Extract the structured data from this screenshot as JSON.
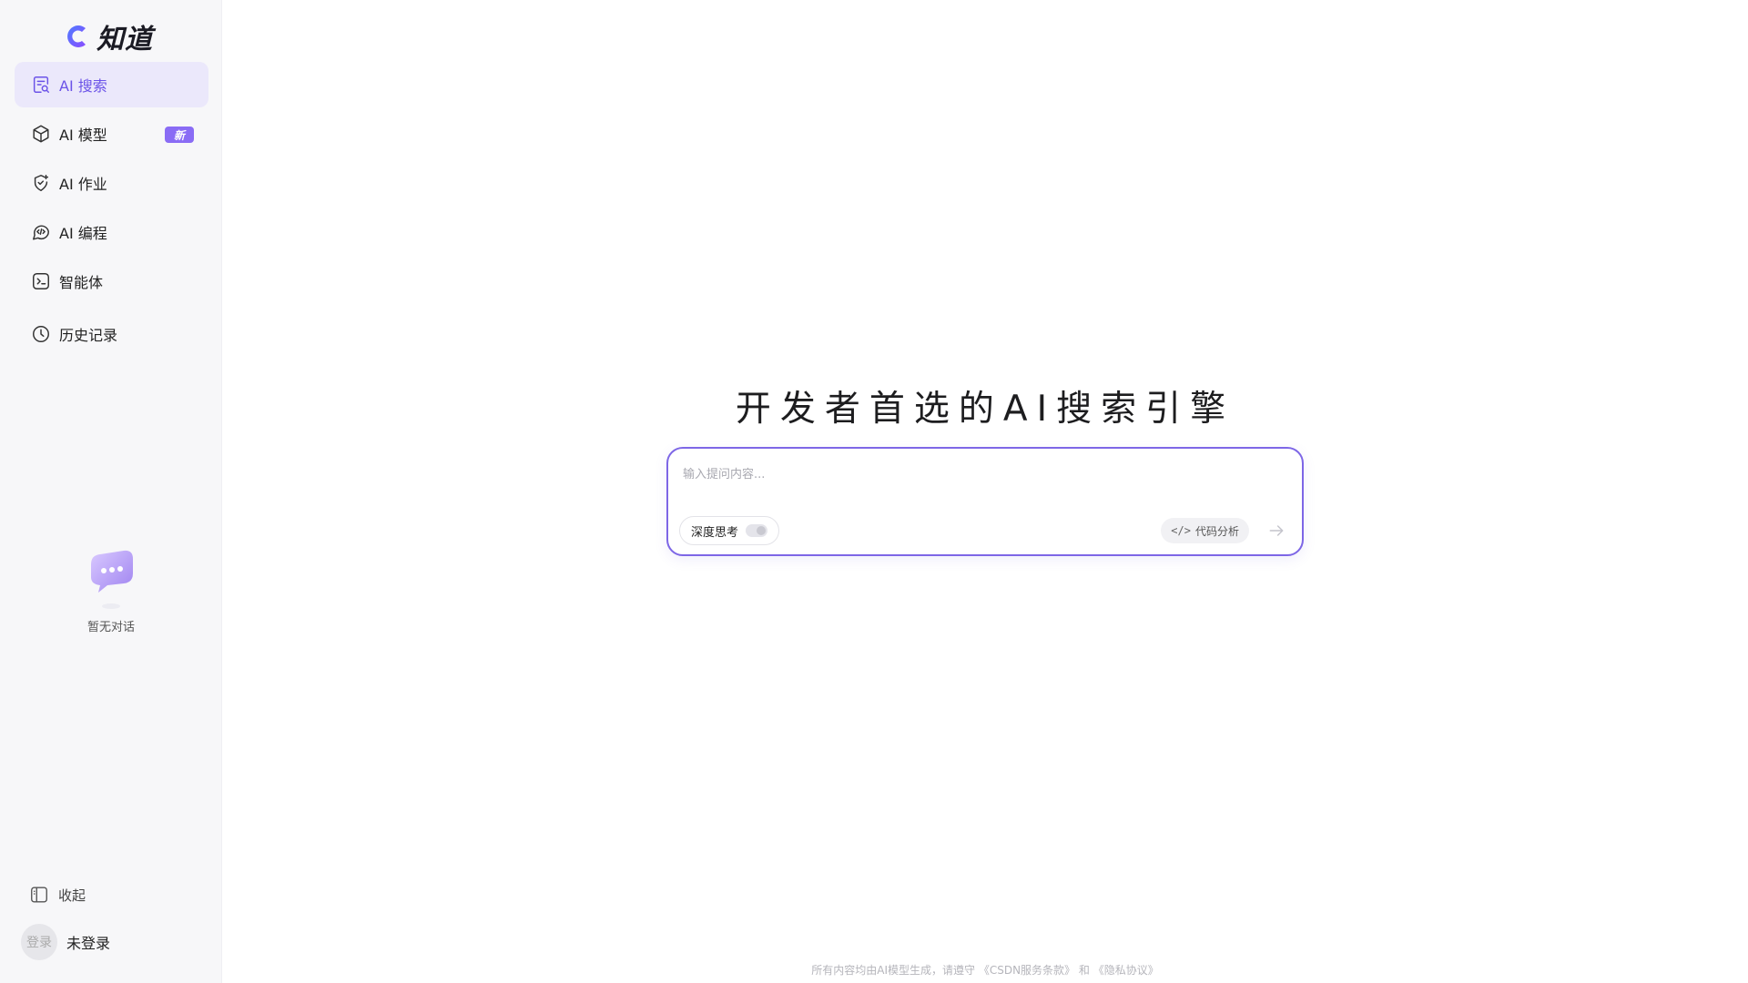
{
  "brand": {
    "name": "知道",
    "accent": "#7d66e6",
    "badge_color": "#8a6cf5"
  },
  "sidebar": {
    "items": [
      {
        "label": "AI 搜索",
        "icon": "ai-search-icon",
        "active": true
      },
      {
        "label": "AI 模型",
        "icon": "cube-icon",
        "badge": "新"
      },
      {
        "label": "AI 作业",
        "icon": "shield-sparkle-icon"
      },
      {
        "label": "AI 编程",
        "icon": "code-chat-icon"
      },
      {
        "label": "智能体",
        "icon": "terminal-icon"
      },
      {
        "label": "历史记录",
        "icon": "clock-icon"
      }
    ],
    "empty_text": "暂无对话",
    "collapse_label": "收起",
    "avatar_text": "登录",
    "user_label": "未登录"
  },
  "main": {
    "headline": "开发者首选的AI搜索引擎",
    "search": {
      "placeholder": "输入提问内容...",
      "deep_think_label": "深度思考",
      "deep_think_enabled": false,
      "code_analysis_icon": "</>",
      "code_analysis_label": "代码分析"
    },
    "footer": {
      "prefix": "所有内容均由AI模型生成，请遵守",
      "link1": "《CSDN服务条款》",
      "and": "和",
      "link2": "《隐私协议》"
    }
  }
}
